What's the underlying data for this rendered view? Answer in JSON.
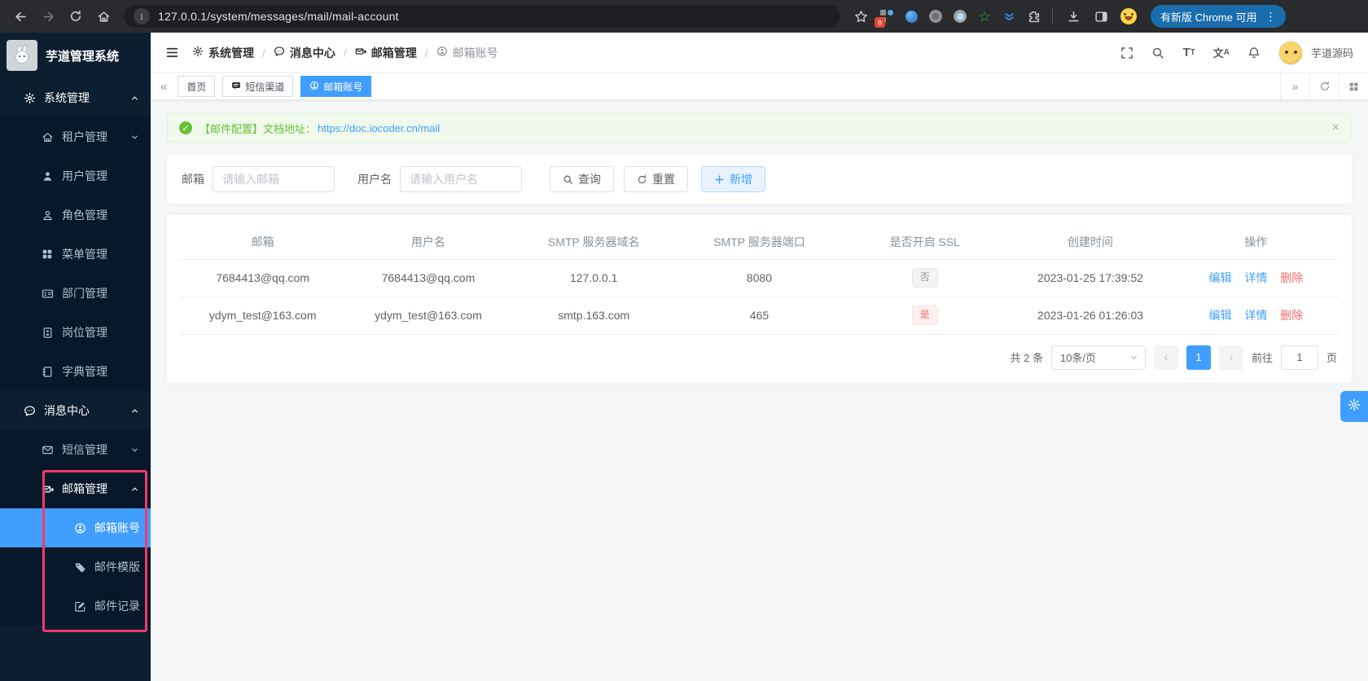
{
  "colors": {
    "accent": "#409eff",
    "success": "#67c23a",
    "danger": "#f56c6c",
    "highlight": "#f5396e"
  },
  "browser": {
    "url": "127.0.0.1/system/messages/mail/mail-account",
    "extension_badge": "8",
    "update_chip": "有新版 Chrome 可用"
  },
  "sidebar": {
    "title": "芋道管理系统",
    "menu": [
      {
        "label": "系统管理"
      },
      {
        "label": "租户管理"
      },
      {
        "label": "用户管理"
      },
      {
        "label": "角色管理"
      },
      {
        "label": "菜单管理"
      },
      {
        "label": "部门管理"
      },
      {
        "label": "岗位管理"
      },
      {
        "label": "字典管理"
      },
      {
        "label": "消息中心"
      },
      {
        "label": "短信管理"
      },
      {
        "label": "邮箱管理"
      },
      {
        "label": "邮箱账号"
      },
      {
        "label": "邮件模版"
      },
      {
        "label": "邮件记录"
      }
    ]
  },
  "navbar": {
    "breadcrumb": [
      {
        "label": "系统管理"
      },
      {
        "label": "消息中心"
      },
      {
        "label": "邮箱管理"
      },
      {
        "label": "邮箱账号"
      }
    ],
    "username": "芋道源码"
  },
  "tabs": [
    {
      "label": "首页"
    },
    {
      "label": "短信渠道"
    },
    {
      "label": "邮箱账号"
    }
  ],
  "alert": {
    "prefix": "【邮件配置】文档地址：",
    "link": "https://doc.iocoder.cn/mail"
  },
  "filters": {
    "email_label": "邮箱",
    "email_placeholder": "请输入邮箱",
    "username_label": "用户名",
    "username_placeholder": "请输入用户名",
    "search": "查询",
    "reset": "重置",
    "add": "新增"
  },
  "table": {
    "columns": [
      "邮箱",
      "用户名",
      "SMTP 服务器域名",
      "SMTP 服务器端口",
      "是否开启 SSL",
      "创建时间",
      "操作"
    ],
    "rows": [
      {
        "mail": "7684413@qq.com",
        "user": "7684413@qq.com",
        "domain": "127.0.0.1",
        "port": "8080",
        "ssl": "否",
        "created": "2023-01-25 17:39:52"
      },
      {
        "mail": "ydym_test@163.com",
        "user": "ydym_test@163.com",
        "domain": "smtp.163.com",
        "port": "465",
        "ssl": "是",
        "created": "2023-01-26 01:26:03"
      }
    ],
    "actions": {
      "edit": "编辑",
      "detail": "详情",
      "del": "删除"
    }
  },
  "pagination": {
    "total": "共 2 条",
    "size": "10条/页",
    "page": "1",
    "goto": "前往",
    "goto_value": "1",
    "unit": "页"
  }
}
